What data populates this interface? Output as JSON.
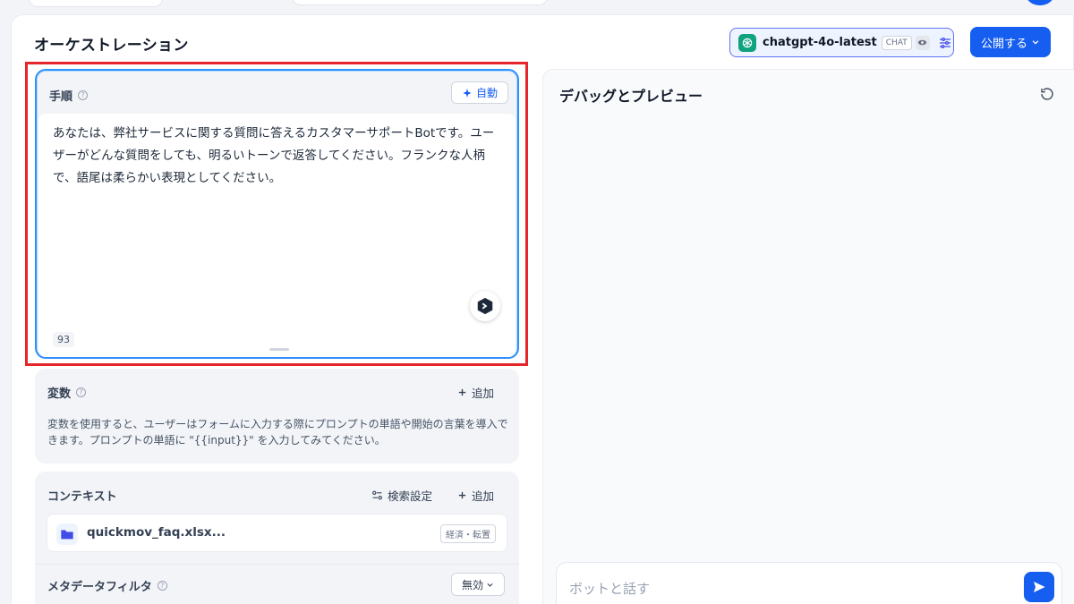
{
  "header": {
    "title": "オーケストレーション",
    "model": {
      "name": "chatgpt-4o-latest",
      "badge": "CHAT"
    },
    "publish_label": "公開する"
  },
  "instructions": {
    "title": "手順",
    "auto_label": "自動",
    "text": "あなたは、弊社サービスに関する質問に答えるカスタマーサポートBotです。ユーザーがどんな質問をしても、明るいトーンで返答してください。フランクな人柄で、語尾は柔らかい表現としてください。",
    "char_count": "93"
  },
  "variables": {
    "title": "変数",
    "add_label": "追加",
    "description": "変数を使用すると、ユーザーはフォームに入力する際にプロンプトの単語や開始の言葉を導入できます。プロンプトの単語に \"{{input}}\" を入力してみてください。"
  },
  "context": {
    "title": "コンテキスト",
    "search_settings_label": "検索設定",
    "add_label": "追加",
    "file": {
      "name": "quickmov_faq.xlsx...",
      "badge": "経済・転置"
    },
    "metadata_filter": {
      "label": "メタデータフィルタ",
      "value": "無効"
    }
  },
  "debug": {
    "title": "デバッグとプレビュー",
    "chat_placeholder": "ボットと話す"
  },
  "colors": {
    "accent": "#155eef",
    "highlight": "#e5252a",
    "focus_border": "#2e90fa"
  }
}
